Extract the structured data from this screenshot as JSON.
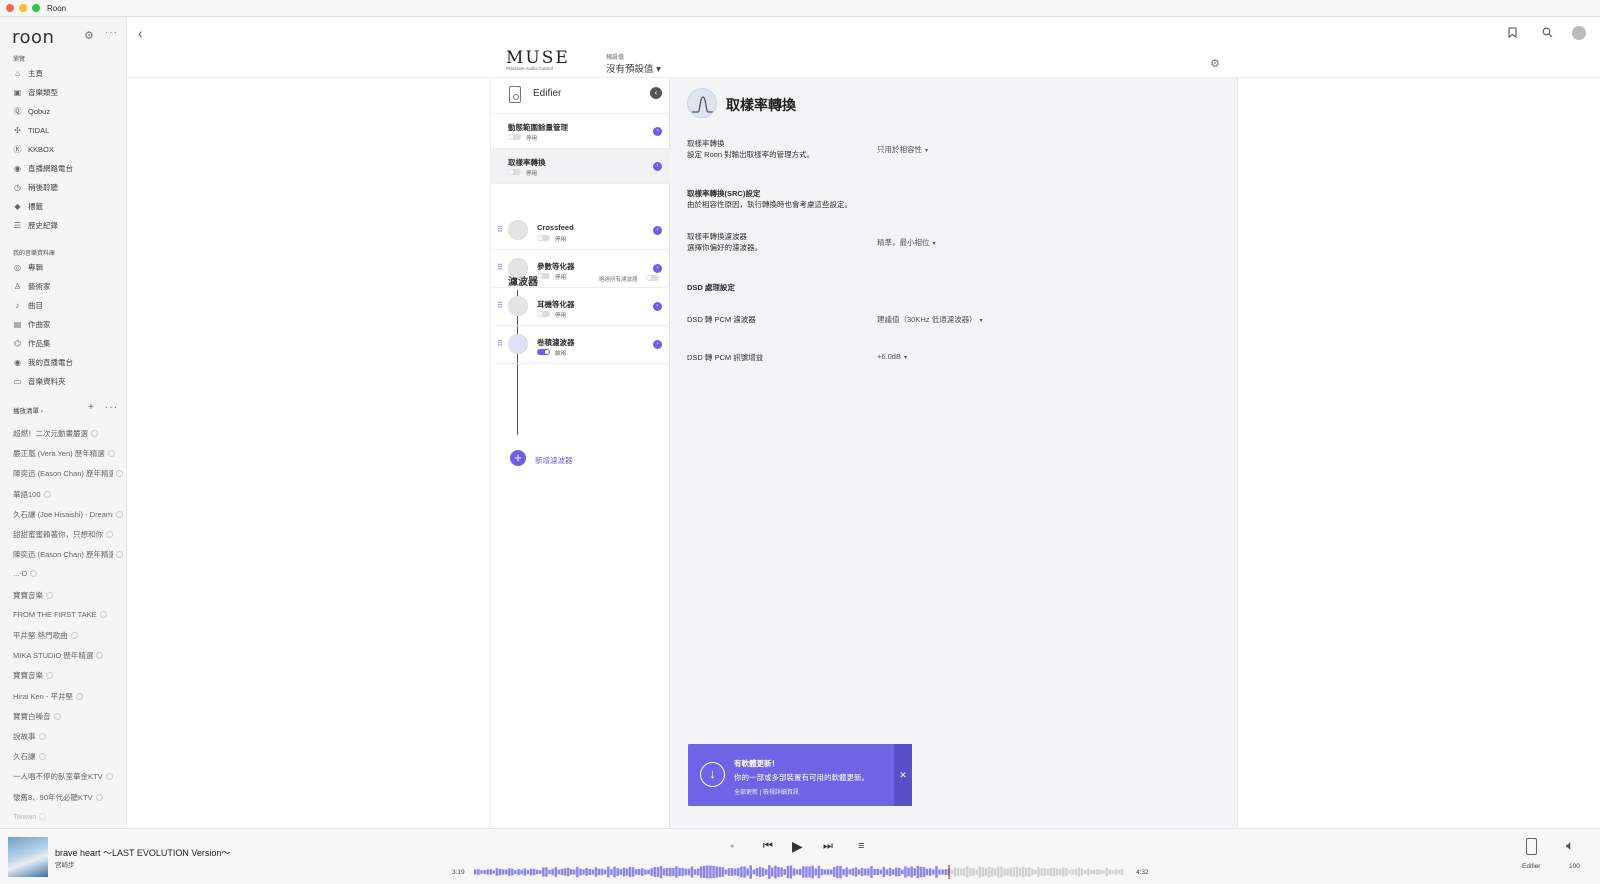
{
  "window": {
    "title": "Roon"
  },
  "sidebar": {
    "logo": "roon",
    "browse_label": "瀏覽",
    "browse": [
      {
        "icon": "home-icon",
        "label": "主頁"
      },
      {
        "icon": "genre-icon",
        "label": "音樂類型"
      },
      {
        "icon": "qobuz-icon",
        "label": "Qobuz"
      },
      {
        "icon": "tidal-icon",
        "label": "TIDAL"
      },
      {
        "icon": "kkbox-icon",
        "label": "KKBOX"
      },
      {
        "icon": "radio-icon",
        "label": "直播網路電台"
      },
      {
        "icon": "recent-icon",
        "label": "稍後聆聽"
      },
      {
        "icon": "tag-icon",
        "label": "標籤"
      },
      {
        "icon": "history-icon",
        "label": "歷史紀錄"
      }
    ],
    "library_label": "我的音樂資料庫",
    "library": [
      {
        "icon": "album-icon",
        "label": "專輯"
      },
      {
        "icon": "artist-icon",
        "label": "藝術家"
      },
      {
        "icon": "track-icon",
        "label": "曲目"
      },
      {
        "icon": "composer-icon",
        "label": "作曲家"
      },
      {
        "icon": "composition-icon",
        "label": "作品集"
      },
      {
        "icon": "my-radio-icon",
        "label": "我的直播電台"
      },
      {
        "icon": "folder-icon",
        "label": "音樂資料夾"
      }
    ],
    "playlists_label": "播放清單 ›",
    "playlists": [
      "超燃！二次元動畫嚴選",
      "嚴正嵐 (Vera Yen) 歷年精選",
      "陳奕迅 (Eason Chan) 歷年精選",
      "華語100",
      "久石讓 (Joe Hisaishi) - Dreams",
      "甜甜蜜蜜賴著你，只想和你",
      "陳奕迅 (Eason Chan) 歷年精選",
      "...-D",
      "寶寶音樂",
      "FROM THE FIRST TAKE",
      "平井堅 熱門歌曲",
      "MIKA STUDIO 歷年精選",
      "寶寶音樂",
      "Hirai Ken - 平井堅",
      "寶寶白噪音",
      "說故事",
      "久石讓",
      "一人唱不停的臥室華金KTV",
      "懷舊8、90年代必聽KTV",
      "Taiwan"
    ]
  },
  "header": {
    "brand": "MUSE",
    "brand_sub": "Precision Audio Control",
    "preset_label": "預設值",
    "preset_value": "沒有預設值 ▾"
  },
  "device": {
    "name": "Edifier",
    "items": [
      {
        "title": "動態範圍餘量管理",
        "state": "停用",
        "on": false
      },
      {
        "title": "取樣率轉換",
        "state": "停用",
        "on": false
      }
    ],
    "filters_title": "濾波器",
    "filters_all_label": "略過所有濾波器",
    "filters": [
      {
        "name": "Crossfeed",
        "state": "停用",
        "on": false
      },
      {
        "name": "參數等化器",
        "state": "停用",
        "on": false
      },
      {
        "name": "耳機等化器",
        "state": "停用",
        "on": false
      },
      {
        "name": "卷積濾波器",
        "state": "啟用",
        "on": true
      }
    ],
    "add_filter": "新增濾波器"
  },
  "detail": {
    "title": "取樣率轉換",
    "settings": [
      {
        "label": "取樣率轉換",
        "desc": "設定 Roon 對輸出取樣率的管理方式。",
        "value": "只用於相容性"
      },
      {
        "label": "取樣率轉換(SRC)設定",
        "desc": "由於相容性原因，執行轉換時也會考慮這些設定。",
        "value": ""
      },
      {
        "label": "取樣率轉換濾波器",
        "desc": "選擇你偏好的濾波器。",
        "value": "精準，最小相位"
      }
    ],
    "dsd_section": "DSD 處理設定",
    "dsd": [
      {
        "label": "DSD 轉 PCM 濾波器",
        "value": "建議值（30KHz 低通濾波器）"
      },
      {
        "label": "DSD 轉 PCM 訊號增益",
        "value": "+6.0dB"
      }
    ]
  },
  "toast": {
    "title": "有軟體更新！",
    "body": "你的一部或多部裝置有可用的軟體更新。",
    "links": "全部更新 | 檢視詳細資訊"
  },
  "player": {
    "track": "brave heart 〜LAST EVOLUTION Version〜",
    "artist": "宮崎步",
    "elapsed": "3:19",
    "duration": "4:32",
    "progress": 0.73,
    "zone": "Edifier",
    "volume": "100"
  },
  "colors": {
    "accent": "#6b5ee8",
    "toast": "#6f63e6"
  }
}
